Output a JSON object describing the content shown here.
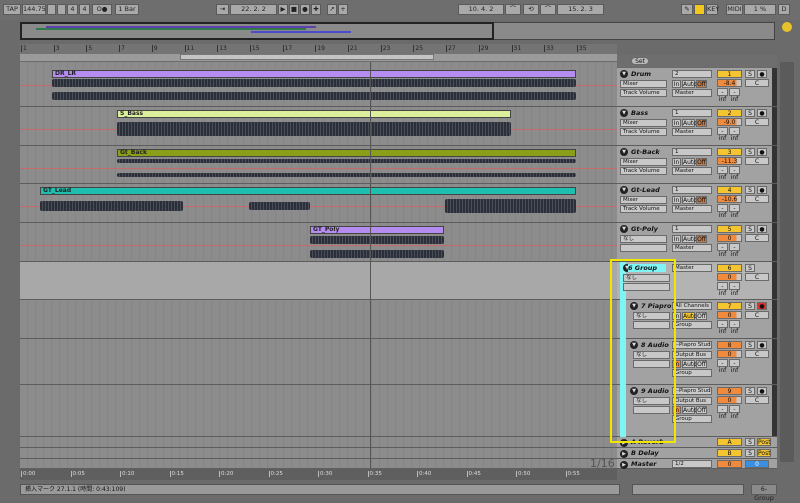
{
  "transport": {
    "tap": "TAP",
    "tempo": "144.75",
    "sig_num": "4",
    "sig_den": "4",
    "metronome": "O●",
    "quantize": "1 Bar",
    "position": "22. 2. 2",
    "loop_start": "10. 4. 2",
    "loop_length": "15. 2. 3",
    "key": "KEY",
    "midi": "MIDI",
    "cpu": "1 %",
    "disk": "D"
  },
  "ruler": {
    "bars": [
      "1",
      "3",
      "5",
      "7",
      "9",
      "11",
      "13",
      "15",
      "17",
      "19",
      "21",
      "23",
      "25",
      "27",
      "29",
      "31",
      "33",
      "35"
    ]
  },
  "timeline": {
    "labels": [
      "0:00",
      "0:05",
      "0:10",
      "0:15",
      "0:20",
      "0:25",
      "0:30",
      "0:35",
      "0:40",
      "0:45",
      "0:50",
      "0:55"
    ],
    "grid": "1/16"
  },
  "clips": [
    {
      "name": "DR_LR",
      "color": "#b58cf0"
    },
    {
      "name": "S_Bass",
      "color": "#dcef9a"
    },
    {
      "name": "Gt_Back",
      "color": "#8a9e1a"
    },
    {
      "name": "GT_Lead",
      "color": "#1fbfb0"
    },
    {
      "name": "GT_Poly",
      "color": "#b58cf0"
    }
  ],
  "set_label": "Set",
  "tracks": [
    {
      "name": "Drum",
      "input": "2",
      "type": "Mixer",
      "ctrl": "Track Volume",
      "out": "Master",
      "num": "1",
      "vol": "-8.4",
      "pan": "C",
      "sends": [
        "-inf",
        "-inf"
      ],
      "monitor": [
        "In",
        "Auto",
        "Off"
      ]
    },
    {
      "name": "Bass",
      "input": "1",
      "type": "Mixer",
      "ctrl": "Track Volume",
      "out": "Master",
      "num": "2",
      "vol": "-9.0",
      "pan": "C",
      "sends": [
        "-inf",
        "-inf"
      ],
      "monitor": [
        "In",
        "Auto",
        "Off"
      ]
    },
    {
      "name": "Gt-Back",
      "input": "1",
      "type": "Mixer",
      "ctrl": "Track Volume",
      "out": "Master",
      "num": "3",
      "vol": "-11.3",
      "pan": "C",
      "sends": [
        "-inf",
        "-inf"
      ],
      "monitor": [
        "In",
        "Auto",
        "Off"
      ]
    },
    {
      "name": "Gt-Lead",
      "input": "1",
      "type": "Mixer",
      "ctrl": "Track Volume",
      "out": "Master",
      "num": "4",
      "vol": "-10.6",
      "pan": "C",
      "sends": [
        "-inf",
        "-inf"
      ],
      "monitor": [
        "In",
        "Auto",
        "Off"
      ]
    },
    {
      "name": "Gt-Poly",
      "input": "1",
      "type": "なし",
      "ctrl": "",
      "out": "Master",
      "num": "5",
      "vol": "0",
      "pan": "C",
      "sends": [
        "-inf",
        "-inf"
      ],
      "monitor": [
        "In",
        "Auto",
        "Off"
      ]
    },
    {
      "name": "6 Group",
      "input": "",
      "type": "なし",
      "ctrl": "",
      "out": "Master",
      "num": "6",
      "vol": "0",
      "pan": "C",
      "sends": [
        "-inf",
        "-inf"
      ],
      "monitor": []
    },
    {
      "name": "7 Piapro S",
      "input": "All Channels",
      "type": "なし",
      "ctrl": "",
      "out": "Group",
      "num": "7",
      "vol": "0",
      "pan": "C",
      "sends": [
        "-inf",
        "-inf"
      ],
      "monitor": [
        "In",
        "Auto",
        "Off"
      ]
    },
    {
      "name": "8 Audio",
      "input": "--Piapro Studio",
      "input2": "Output Bus",
      "type": "なし",
      "ctrl": "",
      "out": "Group",
      "num": "8",
      "vol": "0",
      "pan": "C",
      "sends": [
        "-inf",
        "-inf"
      ],
      "monitor": [
        "In",
        "Auto",
        "Off"
      ]
    },
    {
      "name": "9 Audio",
      "input": "--Piapro Studio",
      "input2": "Output Bus",
      "type": "なし",
      "ctrl": "",
      "out": "Group",
      "num": "9",
      "vol": "0",
      "pan": "C",
      "sends": [
        "-inf",
        "-inf"
      ],
      "monitor": [
        "In",
        "Auto",
        "Off"
      ]
    }
  ],
  "returns": [
    {
      "name": "A Reverb",
      "num": "A",
      "post": "Post"
    },
    {
      "name": "B Delay",
      "num": "B",
      "post": "Post"
    }
  ],
  "master": {
    "name": "Master",
    "out": "1/2",
    "vol": "0",
    "pan": "0"
  },
  "status": {
    "text": "挿入マーク 27.1.1 (時間: 0:43:109)",
    "selected": "6-Group"
  },
  "colors": {
    "track_num": "#f5c531",
    "orange": "#f08a3c",
    "group": "#7ff4f4",
    "highlight": "#f2e600"
  }
}
